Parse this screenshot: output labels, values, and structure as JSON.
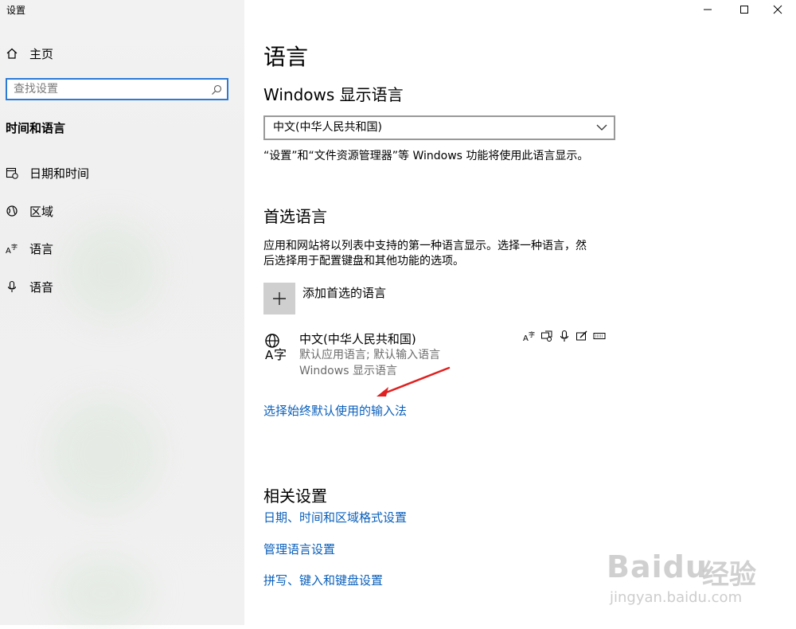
{
  "window": {
    "title": "设置",
    "controls": {
      "minimize_icon": "minimize-icon",
      "maximize_icon": "maximize-icon",
      "close_icon": "close-icon"
    }
  },
  "sidebar": {
    "home_label": "主页",
    "search_placeholder": "查找设置",
    "section_title": "时间和语言",
    "items": [
      {
        "label": "日期和时间",
        "icon": "calendar-clock-icon"
      },
      {
        "label": "区域",
        "icon": "globe-region-icon"
      },
      {
        "label": "语言",
        "icon": "language-icon"
      },
      {
        "label": "语音",
        "icon": "microphone-icon"
      }
    ]
  },
  "main": {
    "title": "语言",
    "display_language": {
      "heading": "Windows 显示语言",
      "selected": "中文(中华人民共和国)",
      "description": "“设置”和“文件资源管理器”等 Windows 功能将使用此语言显示。"
    },
    "preferred": {
      "heading": "首选语言",
      "description_line1": "应用和网站将以列表中支持的第一种语言显示。选择一种语言，然",
      "description_line2": "后选择用于配置键盘和其他功能的选项。",
      "add_label": "添加首选的语言",
      "language": {
        "name": "中文(中华人民共和国)",
        "sub1": "默认应用语言; 默认输入语言",
        "sub2": "Windows 显示语言",
        "feature_icons": [
          "language-pack-icon",
          "speech-icon",
          "microphone-icon",
          "handwriting-icon",
          "keyboard-icon"
        ]
      },
      "input_method_link": "选择始终默认使用的输入法"
    },
    "related": {
      "heading": "相关设置",
      "links": [
        "日期、时间和区域格式设置",
        "管理语言设置",
        "拼写、键入和键盘设置"
      ]
    }
  },
  "annotation": {
    "color": "#e02020"
  },
  "watermark": {
    "brand": "Bai",
    "brand2": "du",
    "product": "经验",
    "url": "jingyan.baidu.com"
  },
  "colors": {
    "accent": "#0a5fba",
    "search_border": "#2b7bd6"
  }
}
